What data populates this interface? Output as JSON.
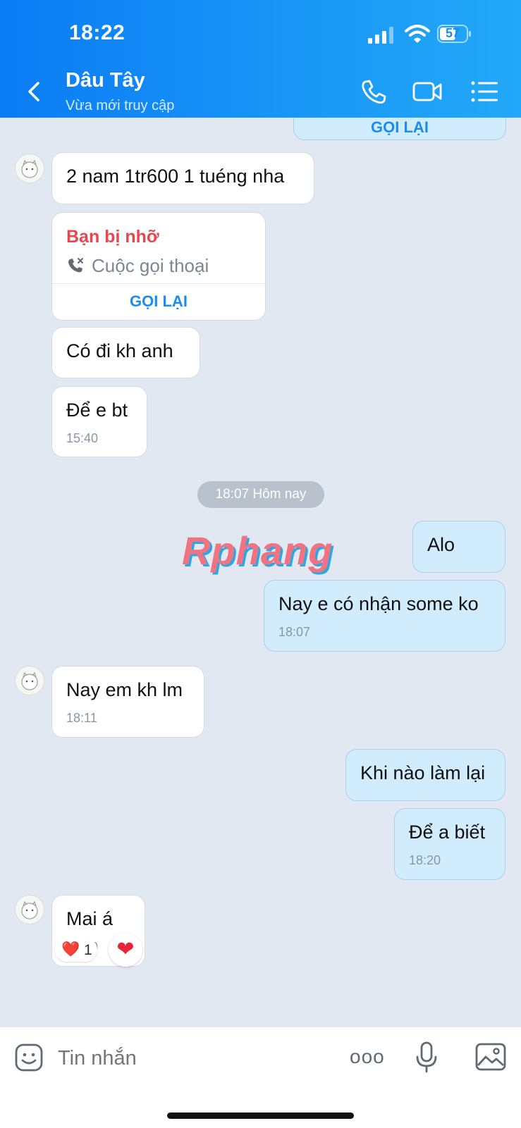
{
  "status_bar": {
    "time": "18:22",
    "battery": "57"
  },
  "header": {
    "title": "Dâu Tây",
    "subtitle": "Vừa mới truy cập"
  },
  "chat": {
    "top_partial_callback": "GỌI LẠI",
    "msg1": "2 nam 1tr600 1 tuéng nha",
    "missed_call": {
      "title": "Bạn bị nhỡ",
      "type": "Cuộc gọi thoại",
      "action": "GỌI LẠI"
    },
    "msg2": "Có đi kh anh",
    "msg3": {
      "text": "Để e bt",
      "time": "15:40"
    },
    "date_separator": "18:07 Hôm nay",
    "watermark": "Rphang",
    "msg4": "Alo",
    "msg5": {
      "text": "Nay e có nhận some ko",
      "time": "18:07"
    },
    "msg6": {
      "text": "Nay em kh lm",
      "time": "18:11"
    },
    "msg7": "Khi nào làm lại",
    "msg8": {
      "text": "Để a biết",
      "time": "18:20"
    },
    "msg9": {
      "text": "Mai á",
      "time": "18:20",
      "reaction": "❤️",
      "reaction_count": "1",
      "react_button": "❤"
    }
  },
  "composer": {
    "placeholder": "Tin nhắn",
    "more_label": "ooo"
  }
}
